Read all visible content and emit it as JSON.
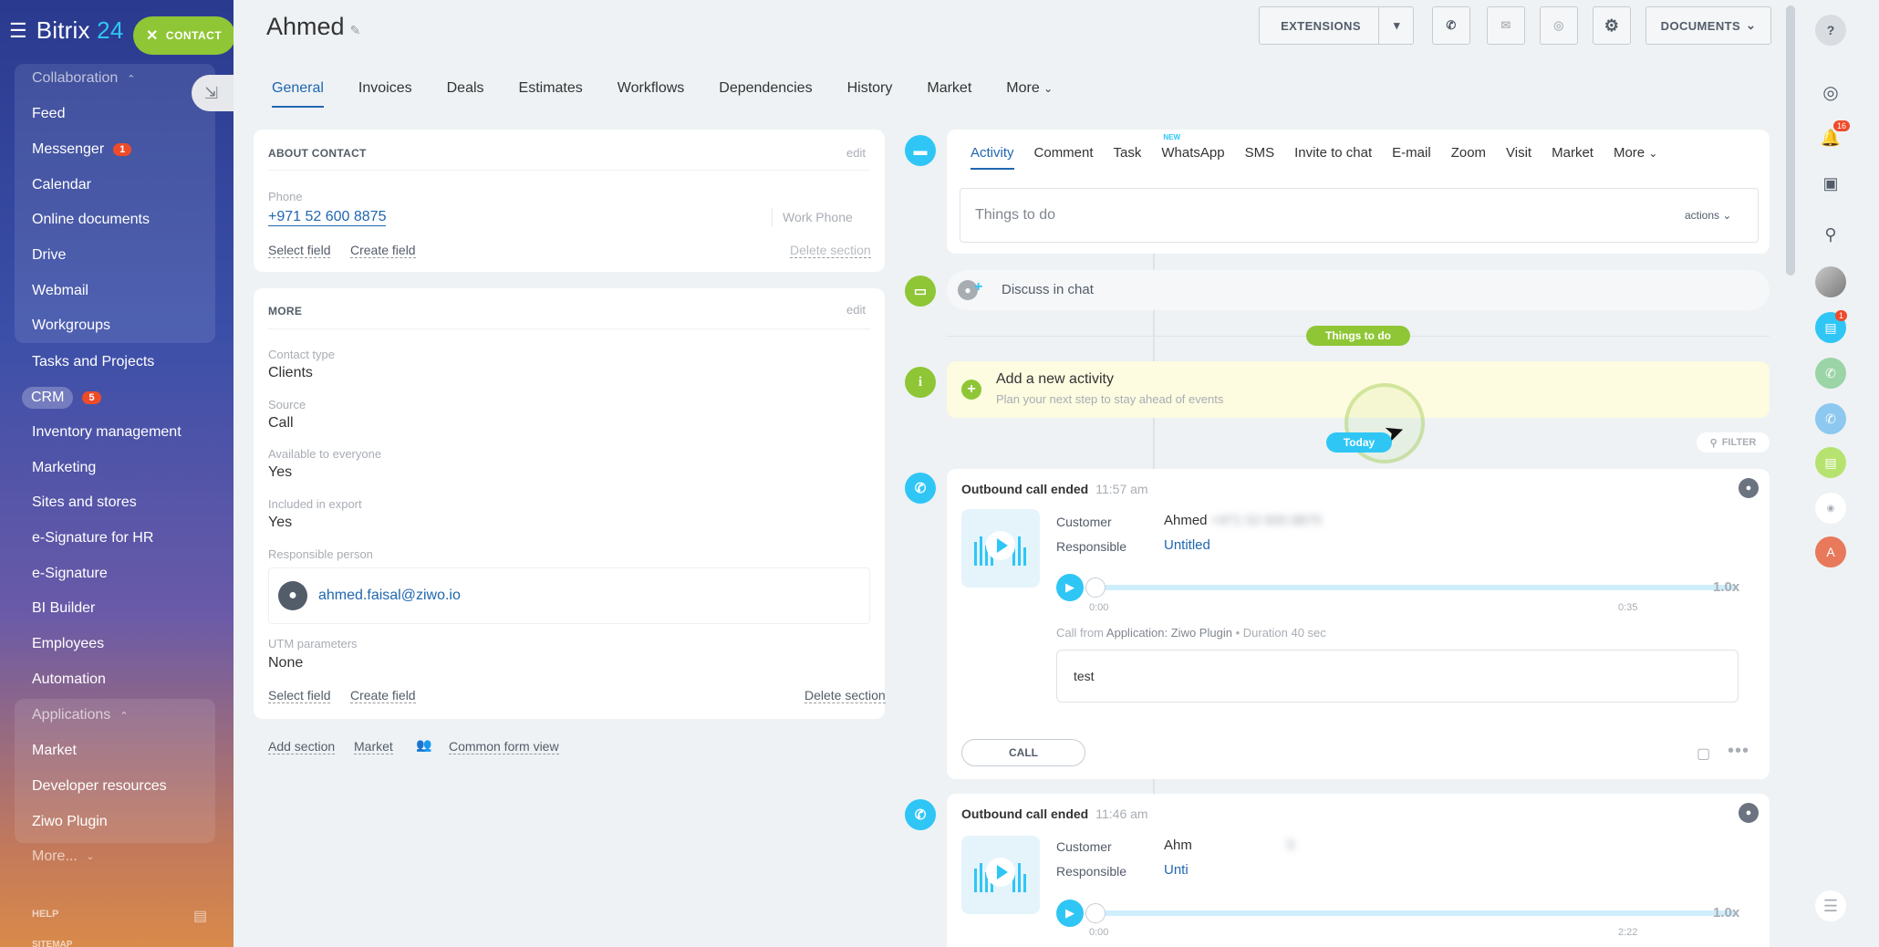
{
  "sidebar": {
    "brand_prefix": "Bitrix",
    "brand_num": "24",
    "contact_button": "CONTACT",
    "collaboration_head": "Collaboration",
    "collab_items": [
      "Feed",
      "Messenger",
      "Calendar",
      "Online documents",
      "Drive",
      "Webmail",
      "Workgroups"
    ],
    "messenger_badge": "1",
    "tasks": "Tasks and Projects",
    "crm": "CRM",
    "crm_badge": "5",
    "main_items": [
      "Inventory management",
      "Marketing",
      "Sites and stores",
      "e-Signature for HR",
      "e-Signature",
      "BI Builder",
      "Employees",
      "Automation"
    ],
    "applications_head": "Applications",
    "app_items": [
      "Market",
      "Developer resources",
      "Ziwo Plugin"
    ],
    "more": "More...",
    "help": "HELP",
    "sitemap": "SITEMAP"
  },
  "header": {
    "title": "Ahmed",
    "extensions": "EXTENSIONS",
    "documents": "DOCUMENTS"
  },
  "tabs": [
    "General",
    "Invoices",
    "Deals",
    "Estimates",
    "Workflows",
    "Dependencies",
    "History",
    "Market",
    "More"
  ],
  "about": {
    "title": "ABOUT CONTACT",
    "edit": "edit",
    "phone_label": "Phone",
    "phone_value": "+971 52 600 8875",
    "phone_type": "Work Phone",
    "select_field": "Select field",
    "create_field": "Create field",
    "delete_section": "Delete section"
  },
  "more": {
    "title": "MORE",
    "edit": "edit",
    "contact_type_label": "Contact type",
    "contact_type": "Clients",
    "source_label": "Source",
    "source": "Call",
    "available_label": "Available to everyone",
    "available": "Yes",
    "export_label": "Included in export",
    "export": "Yes",
    "responsible_label": "Responsible person",
    "responsible": "ahmed.faisal@ziwo.io",
    "utm_label": "UTM parameters",
    "utm": "None",
    "select_field": "Select field",
    "create_field": "Create field",
    "delete_section": "Delete section"
  },
  "footer_links": {
    "add_section": "Add section",
    "market": "Market",
    "common_form": "Common form view"
  },
  "activity": {
    "tabs": [
      "Activity",
      "Comment",
      "Task",
      "WhatsApp",
      "SMS",
      "Invite to chat",
      "E-mail",
      "Zoom",
      "Visit",
      "Market",
      "More"
    ],
    "new_label": "NEW",
    "todo_placeholder": "Things to do",
    "actions": "actions",
    "discuss": "Discuss in chat",
    "things_pill": "Things to do",
    "add_title": "Add a new activity",
    "add_sub": "Plan your next step to stay ahead of events",
    "today": "Today",
    "filter": "FILTER"
  },
  "calls": [
    {
      "title": "Outbound call ended",
      "time": "11:57 am",
      "customer_label": "Customer",
      "customer": "Ahmed",
      "customer_phone": "+971 52 600 8875",
      "responsible_label": "Responsible",
      "responsible": "Untitled",
      "start": "0:00",
      "end": "0:35",
      "speed": "1.0x",
      "info_prefix": "Call from",
      "info_app": "Application: Ziwo Plugin",
      "info_dur": "• Duration 40 sec",
      "note": "test",
      "call_btn": "CALL"
    },
    {
      "title": "Outbound call ended",
      "time": "11:46 am",
      "customer_label": "Customer",
      "customer": "Ahm",
      "customer_phone": "5",
      "responsible_label": "Responsible",
      "responsible": "Unti",
      "start": "0:00",
      "end": "2:22",
      "speed": "1.0x"
    }
  ],
  "rightbar": {
    "bell_badge": "16",
    "chat_badge": "1",
    "avatar_letter": "A"
  },
  "colors": {
    "accent": "#2067b0",
    "green": "#8fc636",
    "cyan": "#2fc6f6"
  }
}
